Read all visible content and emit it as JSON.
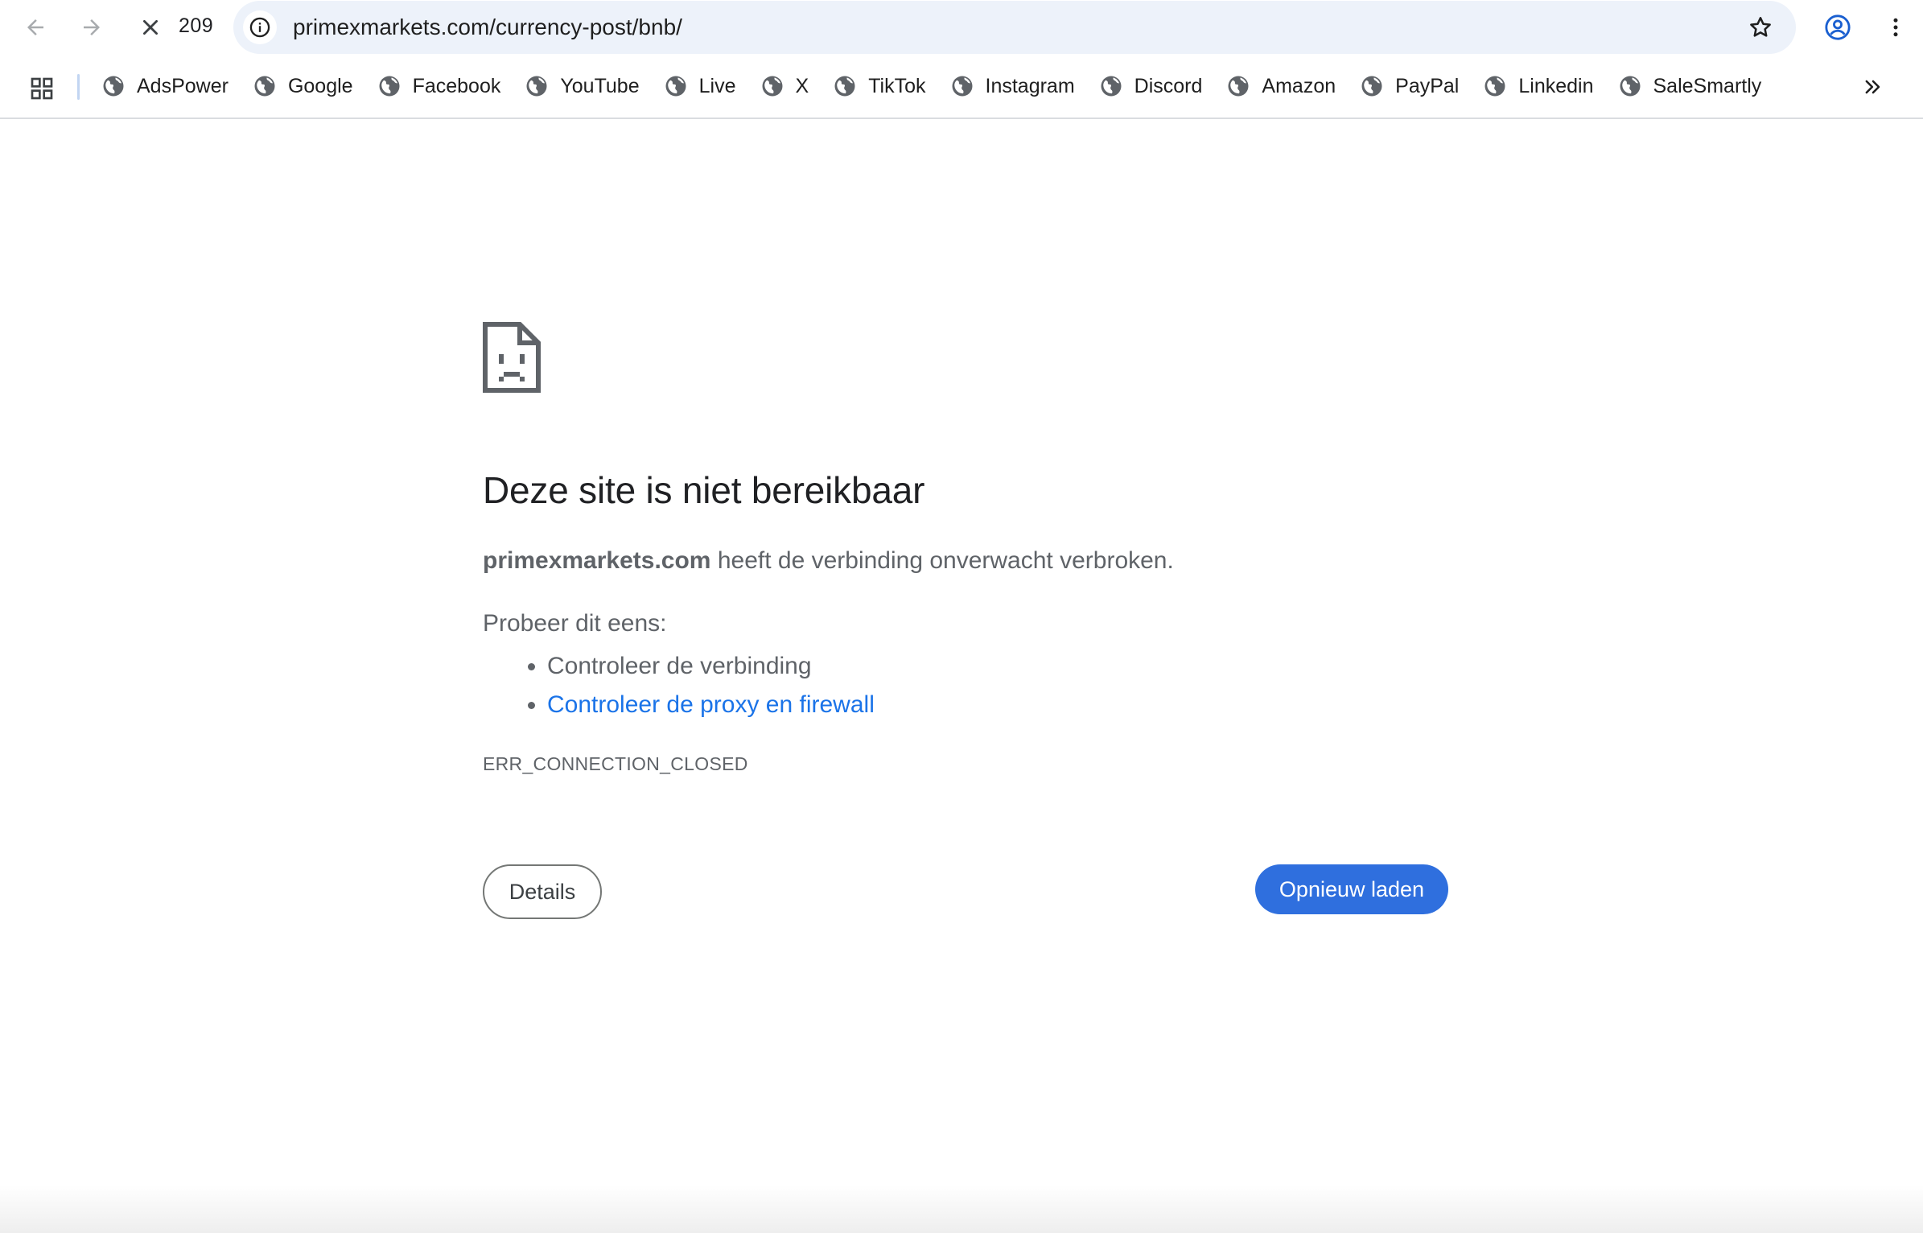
{
  "browser": {
    "tab_count": "209",
    "url": "primexmarkets.com/currency-post/bnb/",
    "icons": {
      "back": "back-arrow-icon",
      "forward": "forward-arrow-icon",
      "stop": "close-icon",
      "site_info": "info-icon",
      "bookmark": "star-icon",
      "profile": "profile-icon",
      "menu": "kebab-menu-icon"
    }
  },
  "bookmarks": {
    "apps_icon": "apps-grid-icon",
    "items": [
      {
        "label": "AdsPower"
      },
      {
        "label": "Google"
      },
      {
        "label": "Facebook"
      },
      {
        "label": "YouTube"
      },
      {
        "label": "Live"
      },
      {
        "label": "X"
      },
      {
        "label": "TikTok"
      },
      {
        "label": "Instagram"
      },
      {
        "label": "Discord"
      },
      {
        "label": "Amazon"
      },
      {
        "label": "PayPal"
      },
      {
        "label": "Linkedin"
      },
      {
        "label": "SaleSmartly"
      }
    ],
    "more_icon": "double-chevron-right-icon"
  },
  "error_page": {
    "icon": "sad-page-icon",
    "title": "Deze site is niet bereikbaar",
    "host": "primexmarkets.com",
    "description_rest": " heeft de verbinding onverwacht verbroken.",
    "try_heading": "Probeer dit eens:",
    "suggestions": [
      "Controleer de verbinding",
      "Controleer de proxy en firewall"
    ],
    "error_code": "ERR_CONNECTION_CLOSED",
    "details_label": "Details",
    "reload_label": "Opnieuw laden"
  },
  "colors": {
    "accent": "#1a73e8",
    "reload_button": "#2f6fde",
    "omnibox_bg": "#edf2fa",
    "text_secondary": "#5f6368"
  }
}
